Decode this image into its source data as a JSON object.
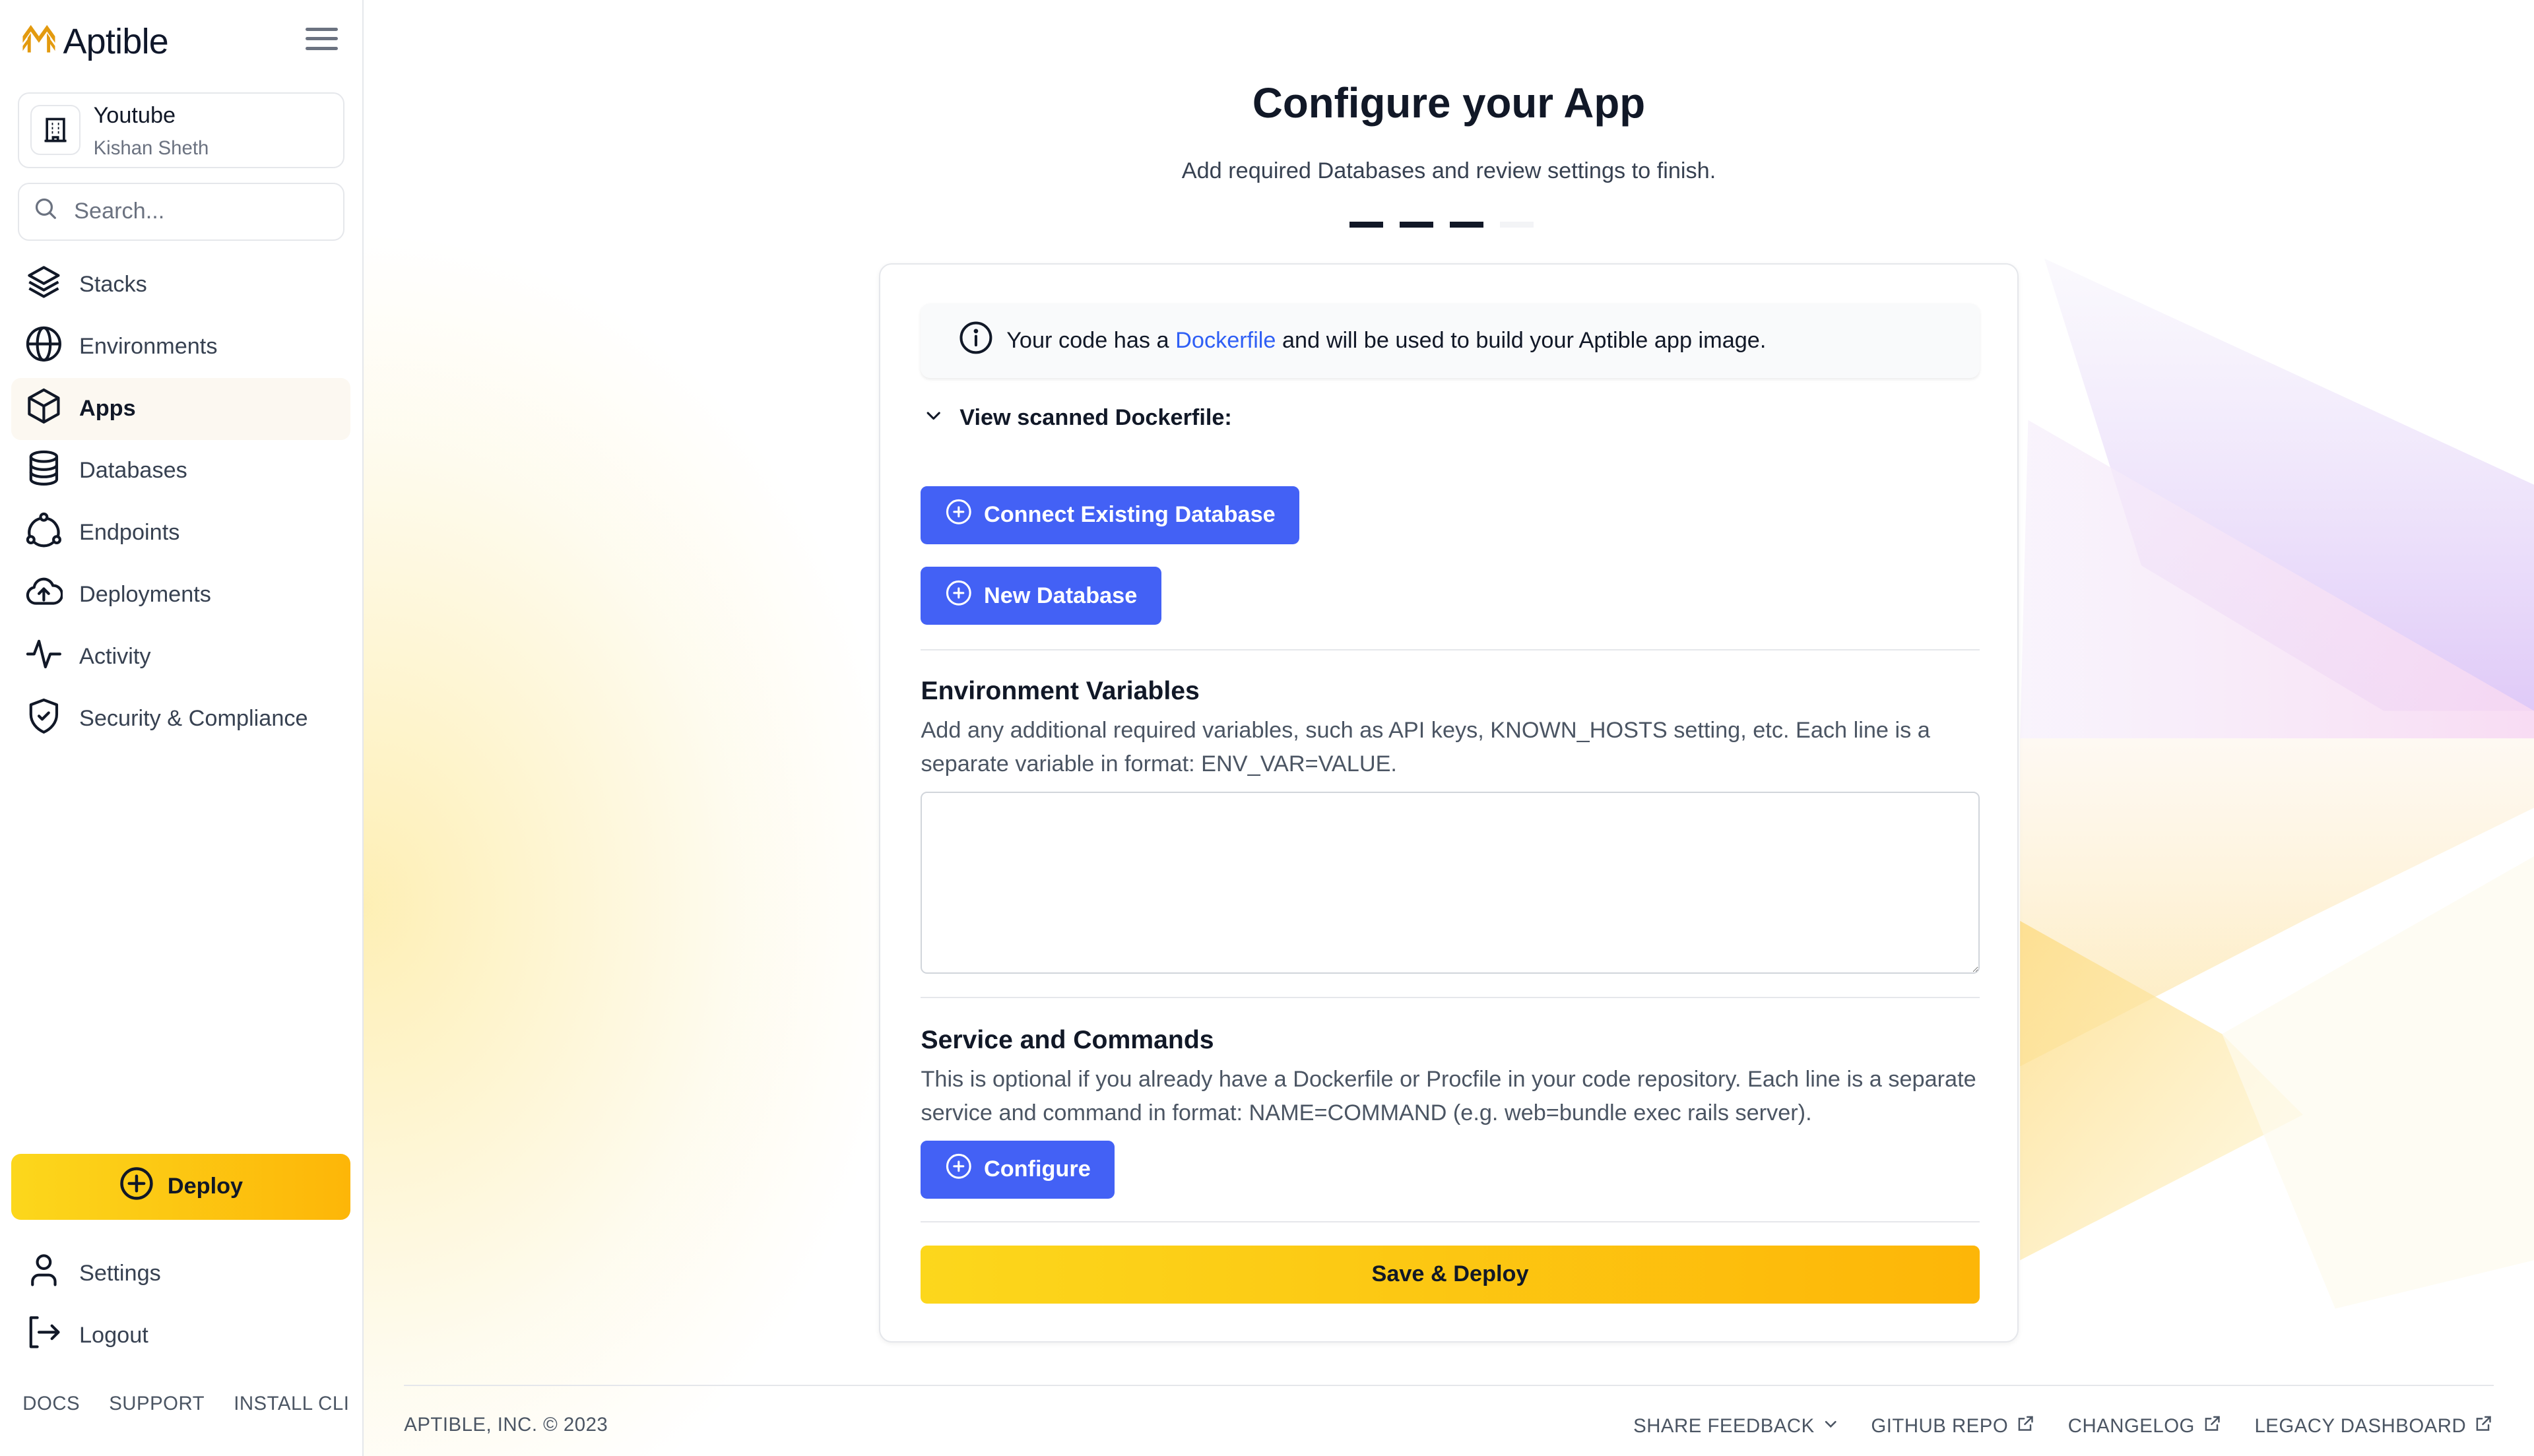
{
  "brand": {
    "name": "Aptible",
    "logo_color": "#e39a0e"
  },
  "org": {
    "name": "Youtube",
    "user": "Kishan Sheth"
  },
  "search": {
    "placeholder": "Search..."
  },
  "sidebar": {
    "items": [
      {
        "label": "Stacks",
        "icon": "layers-icon",
        "active": false
      },
      {
        "label": "Environments",
        "icon": "globe-icon",
        "active": false
      },
      {
        "label": "Apps",
        "icon": "cube-icon",
        "active": true
      },
      {
        "label": "Databases",
        "icon": "database-icon",
        "active": false
      },
      {
        "label": "Endpoints",
        "icon": "endpoints-icon",
        "active": false
      },
      {
        "label": "Deployments",
        "icon": "cloud-upload-icon",
        "active": false
      },
      {
        "label": "Activity",
        "icon": "activity-icon",
        "active": false
      },
      {
        "label": "Security & Compliance",
        "icon": "shield-check-icon",
        "active": false
      }
    ],
    "deploy_label": "Deploy",
    "bottom_items": [
      {
        "label": "Settings",
        "icon": "user-icon"
      },
      {
        "label": "Logout",
        "icon": "logout-icon"
      }
    ],
    "links": [
      "DOCS",
      "SUPPORT",
      "INSTALL CLI"
    ]
  },
  "page": {
    "title": "Configure your App",
    "subtitle": "Add required Databases and review settings to finish.",
    "steps": {
      "total": 4,
      "completed": 3
    }
  },
  "card": {
    "info": {
      "prefix": "Your code has a ",
      "link": "Dockerfile",
      "suffix": " and will be used to build your Aptible app image."
    },
    "disclosure_label": "View scanned Dockerfile:",
    "connect_db_label": "Connect Existing Database",
    "new_db_label": "New Database",
    "env": {
      "title": "Environment Variables",
      "description": "Add any additional required variables, such as API keys, KNOWN_HOSTS setting, etc. Each line is a separate variable in format: ENV_VAR=VALUE.",
      "value": ""
    },
    "services": {
      "title": "Service and Commands",
      "description": "This is optional if you already have a Dockerfile or Procfile in your code repository. Each line is a separate service and command in format: NAME=COMMAND (e.g. web=bundle exec rails server).",
      "configure_label": "Configure"
    },
    "save_label": "Save & Deploy"
  },
  "footer": {
    "copyright": "APTIBLE, INC. © 2023",
    "links": [
      {
        "label": "SHARE FEEDBACK",
        "icon": "chevron-down-icon"
      },
      {
        "label": "GITHUB REPO",
        "icon": "external-link-icon"
      },
      {
        "label": "CHANGELOG",
        "icon": "external-link-icon"
      },
      {
        "label": "LEGACY DASHBOARD",
        "icon": "external-link-icon"
      }
    ]
  },
  "colors": {
    "primary_blue": "#4361f5",
    "link_blue": "#2f5ff5",
    "deploy_gradient_start": "#fcd71c",
    "deploy_gradient_end": "#fdb608",
    "active_nav_bg": "#fcf8f1"
  }
}
